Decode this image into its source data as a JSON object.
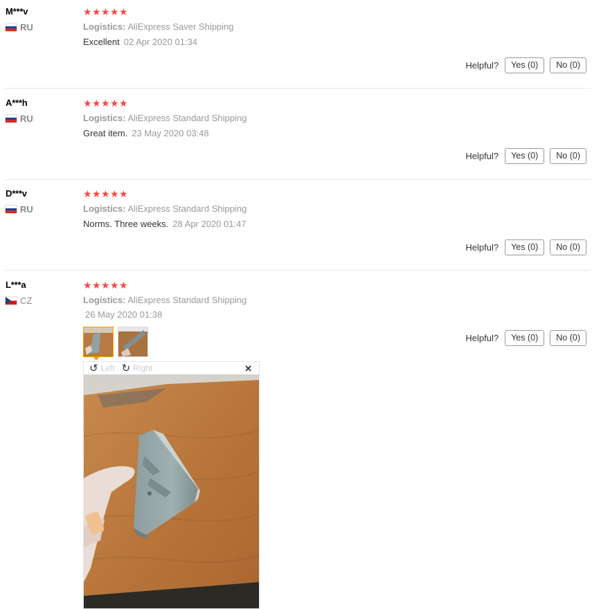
{
  "reviews": [
    {
      "user": "M***v",
      "country": "RU",
      "flag_colors": [
        "#ffffff",
        "#1c3fa8",
        "#d52b1e"
      ],
      "stars": 5,
      "logistics_label": "Logistics:",
      "logistics_value": "AliExpress Saver Shipping",
      "text": "Excellent",
      "date": "02 Apr 2020 01:34",
      "helpful_label": "Helpful?",
      "yes_label": "Yes (0)",
      "no_label": "No (0)"
    },
    {
      "user": "A***h",
      "country": "RU",
      "flag_colors": [
        "#ffffff",
        "#1c3fa8",
        "#d52b1e"
      ],
      "stars": 5,
      "logistics_label": "Logistics:",
      "logistics_value": "AliExpress Standard Shipping",
      "text": "Great item.",
      "date": "23 May 2020 03:48",
      "helpful_label": "Helpful?",
      "yes_label": "Yes (0)",
      "no_label": "No (0)"
    },
    {
      "user": "D***v",
      "country": "RU",
      "flag_colors": [
        "#ffffff",
        "#1c3fa8",
        "#d52b1e"
      ],
      "stars": 5,
      "logistics_label": "Logistics:",
      "logistics_value": "AliExpress Standard Shipping",
      "text": "Norms. Three weeks.",
      "date": "28 Apr 2020 01:47",
      "helpful_label": "Helpful?",
      "yes_label": "Yes (0)",
      "no_label": "No (0)"
    },
    {
      "user": "L***a",
      "country": "CZ",
      "flag_colors": [
        "#ffffff",
        "#d7141a",
        "#11457e"
      ],
      "stars": 5,
      "logistics_label": "Logistics:",
      "logistics_value": "AliExpress Standard Shipping",
      "text": "",
      "date": "26 May 2020 01:38",
      "helpful_label": "Helpful?",
      "yes_label": "Yes (0)",
      "no_label": "No (0)"
    }
  ],
  "image_viewer": {
    "rotate_left_label": "Left",
    "rotate_right_label": "Right",
    "rotate_left_icon": "rotate-left-icon",
    "rotate_right_icon": "rotate-right-icon",
    "close_icon": "close-icon"
  },
  "colors": {
    "star": "#ff4747",
    "thumb_active_border": "#ff9900"
  }
}
